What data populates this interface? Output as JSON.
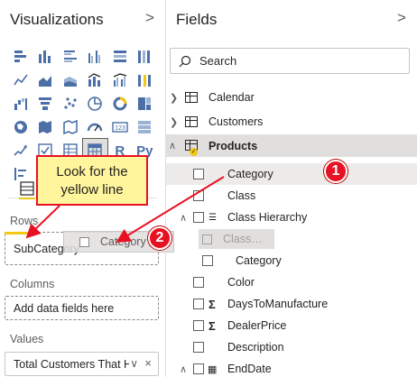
{
  "visualizations": {
    "title": "Visualizations",
    "chevron": ">",
    "custom_icons": [
      "R",
      "Py"
    ],
    "wells": {
      "rows_label": "Rows",
      "rows_value": "SubCategory",
      "columns_label": "Columns",
      "columns_placeholder": "Add data fields here",
      "values_label": "Values",
      "values_value": "Total Customers That Ha",
      "values_chevron": "∨",
      "values_remove": "×"
    },
    "drag_ghost_label": "Category"
  },
  "fields": {
    "title": "Fields",
    "chevron": ">",
    "search_placeholder": "Search",
    "tables": [
      {
        "name": "Calendar",
        "expanded": false
      },
      {
        "name": "Customers",
        "expanded": false
      },
      {
        "name": "Products",
        "expanded": true
      }
    ],
    "products_fields": {
      "category": "Category",
      "class": "Class",
      "class_hierarchy": "Class Hierarchy",
      "hierarchy_ghost": "Class",
      "hierarchy_category": "Category",
      "color": "Color",
      "days_to_manufacture": "DaysToManufacture",
      "dealer_price": "DealerPrice",
      "description": "Description",
      "end_date": "EndDate"
    }
  },
  "annotations": {
    "callout_text": "Look for the yellow line",
    "step1": "1",
    "step2": "2"
  },
  "colors": {
    "accent_yellow": "#f2c811",
    "annotation_red": "#e81123",
    "callout_fill": "#fff59d"
  }
}
